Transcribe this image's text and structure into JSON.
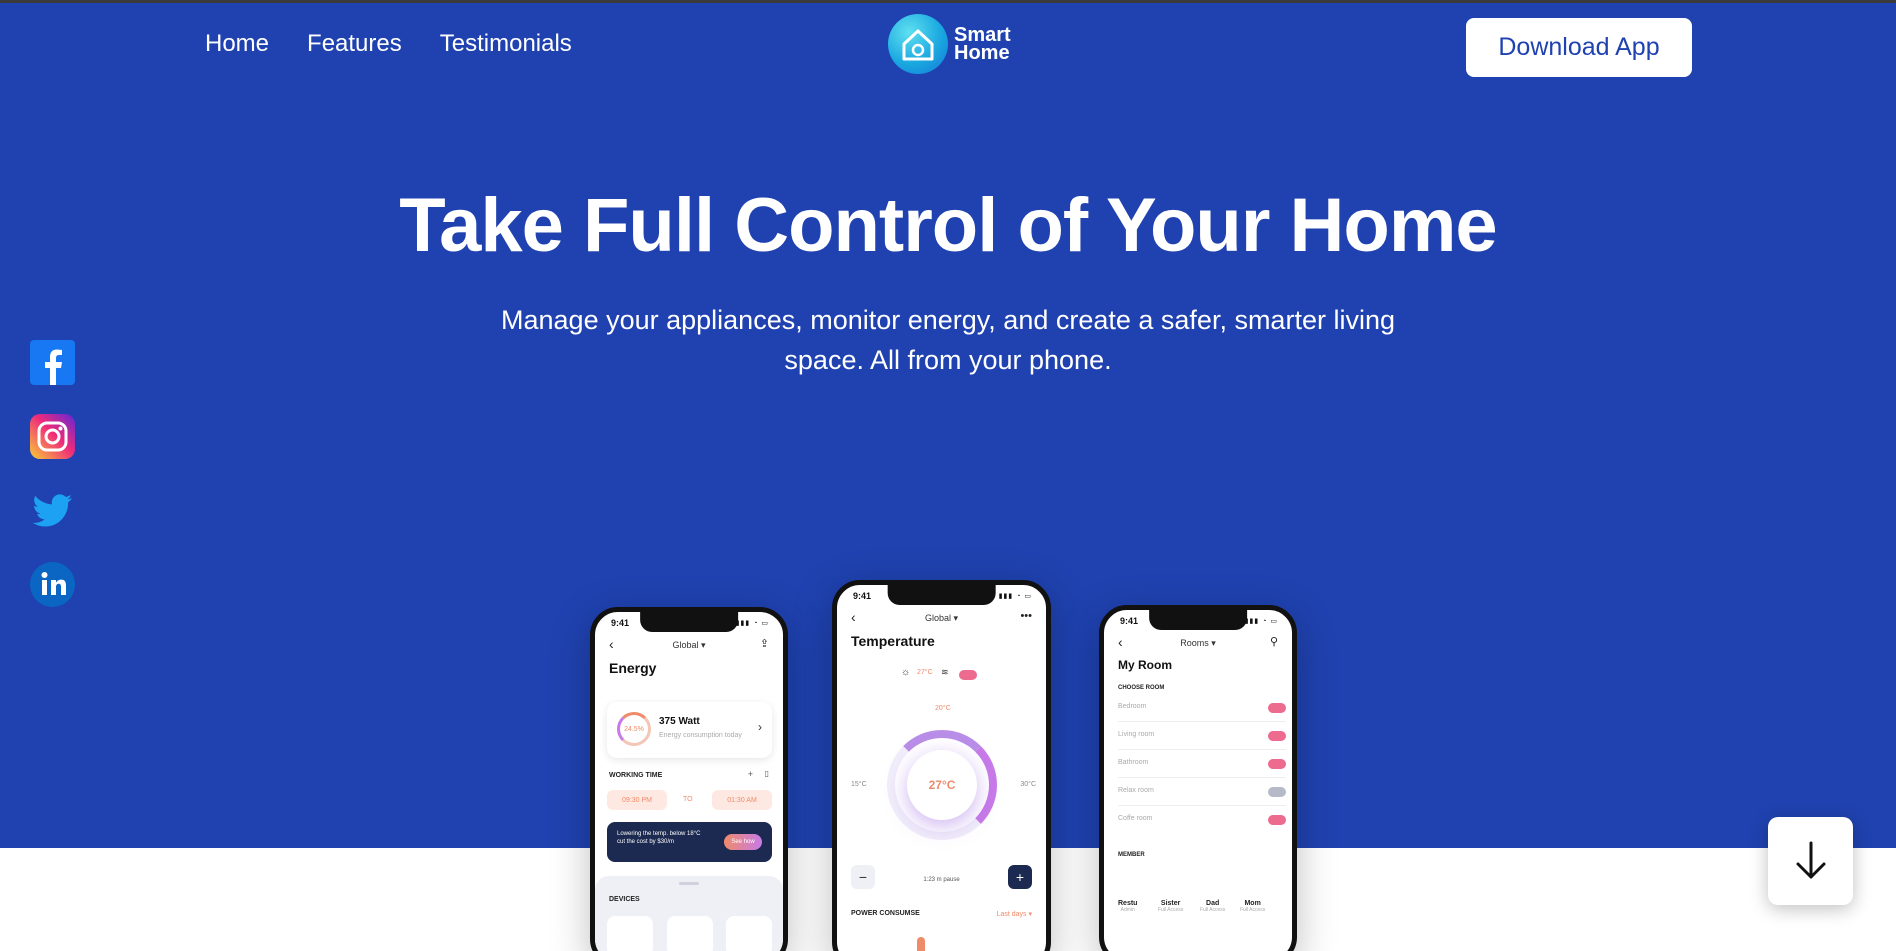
{
  "nav": {
    "links": [
      "Home",
      "Features",
      "Testimonials"
    ],
    "logo": {
      "line1": "Smart",
      "line2": "Home"
    },
    "download_label": "Download App"
  },
  "hero": {
    "title": "Take Full Control of Your Home",
    "subtitle": "Manage your appliances, monitor energy, and create a safer, smarter living space. All from your phone."
  },
  "social": [
    "facebook-icon",
    "instagram-icon",
    "twitter-icon",
    "linkedin-icon"
  ],
  "phones": {
    "energy": {
      "time": "9:41",
      "header": "Global",
      "title": "Energy",
      "ring_label": "24.5%",
      "watt": "375 Watt",
      "watt_sub": "Energy consumption today",
      "working_time": "WORKING TIME",
      "from": "09:30 PM",
      "to_label": "TO",
      "to": "01:30 AM",
      "promo": "Lowering the temp. below 18°C cut the cost by $30/m",
      "promo_btn": "See how",
      "devices": "DEVICES"
    },
    "temperature": {
      "time": "9:41",
      "header": "Global",
      "title": "Temperature",
      "mode_temp": "27°C",
      "top_label": "20°C",
      "left_label": "15°C",
      "right_label": "30°C",
      "center": "27°C",
      "pause": "1:23 m pause",
      "power": "POWER CONSUMSE",
      "last_days": "Last days"
    },
    "rooms": {
      "time": "9:41",
      "header": "Rooms",
      "title": "My Room",
      "choose": "CHOOSE ROOM",
      "items": [
        {
          "name": "Bedroom",
          "on": true
        },
        {
          "name": "Living room",
          "on": true
        },
        {
          "name": "Bathroom",
          "on": true
        },
        {
          "name": "Relax room",
          "on": false
        },
        {
          "name": "Coffe room",
          "on": true
        }
      ],
      "member_label": "MEMBER",
      "members": [
        {
          "name": "Restu",
          "role": "Admin"
        },
        {
          "name": "Sister",
          "role": "Full Access"
        },
        {
          "name": "Dad",
          "role": "Full Access"
        },
        {
          "name": "Mom",
          "role": "Full Access"
        }
      ]
    }
  },
  "colors": {
    "hero": "#1f42b0",
    "accent": "#f08b6a",
    "toggle_on": "#ec6b8f"
  }
}
